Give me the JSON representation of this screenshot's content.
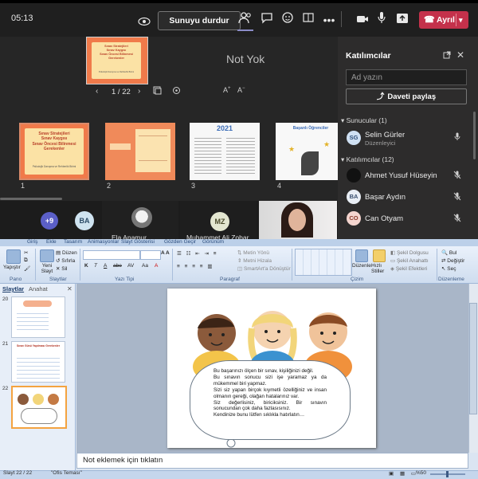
{
  "teams": {
    "timer": "05:13",
    "stop_share_label": "Sunuyu durdur",
    "leave_label": "Ayrıl",
    "stage_message": "Not Yok",
    "slide_pager": "1 / 22",
    "preview_title_lines": [
      "Sınav Stratejileri",
      "Sınav Kaygısı",
      "Sınav Öncesi Bilinmesi",
      "Gerekenler"
    ],
    "preview_footer": "Psikolojik Danışma ve Rehberlik Birimi",
    "thumbnails": [
      {
        "num": "1",
        "lines": [
          "Sınav Stratejileri",
          "Sınav Kaygısı",
          "Sınav Öncesi Bilinmesi",
          "Gerekenler"
        ],
        "footer": "Psikolojik Danışma ve Rehberlik Birimi"
      },
      {
        "num": "2"
      },
      {
        "num": "3",
        "heading": "2021"
      },
      {
        "num": "4",
        "heading": "Başarılı Öğrenciler"
      }
    ],
    "video_tiles": [
      {
        "initials": "+9"
      },
      {
        "initials": "BA"
      },
      {
        "name": "Ela Anamur"
      },
      {
        "initials": "MZ",
        "name": "Muhammet Ali Zobar"
      },
      {
        "type": "camera"
      }
    ],
    "panel": {
      "title": "Katılımcılar",
      "search_placeholder": "Ad yazın",
      "invite_label": "Daveti paylaş",
      "presenters_header": "Sunucular (1)",
      "attendees_header": "Katılımcılar (12)",
      "presenters": [
        {
          "initials": "SG",
          "name": "Selin Gürler",
          "role": "Düzenleyici",
          "color": "#cfe0f3"
        }
      ],
      "attendees": [
        {
          "initials": "",
          "name": "Ahmet Yusuf Hüseyin",
          "color": "#111111"
        },
        {
          "initials": "BA",
          "name": "Başar Aydın",
          "color": "#e9eef5"
        },
        {
          "initials": "CO",
          "name": "Can Otyam",
          "color": "#f4d5cf"
        }
      ]
    }
  },
  "ppt": {
    "ribbon_tabs": [
      "Giriş",
      "Ekle",
      "Tasarım",
      "Animasyonlar",
      "Slayt Gösterisi",
      "Gözden Geçir",
      "Görünüm"
    ],
    "ribbon_groups": [
      "Pano",
      "Slaytlar",
      "Yazı Tipi",
      "Paragraf",
      "Çizim",
      "Düzenleme"
    ],
    "pano_buttons": [
      "Yapıştır",
      "Kes",
      "Kopyala",
      "Biçim Boyacısı"
    ],
    "slaytlar_buttons": [
      "Yeni Slayt",
      "Düzen",
      "Sıfırla",
      "Sil"
    ],
    "paragraf_buttons": [
      "Metin Yönü",
      "Metni Hizala",
      "SmartArt'a Dönüştür"
    ],
    "cizim_buttons": [
      "Düzenle",
      "Hızlı Stiller",
      "Şekil Dolgusu",
      "Şekil Anahattı",
      "Şekil Efektleri"
    ],
    "duzenleme_buttons": [
      "Bul",
      "Değiştir",
      "Seç"
    ],
    "left_tabs": [
      "Slaytlar",
      "Anahat"
    ],
    "left_thumbnails": [
      {
        "num": "20"
      },
      {
        "num": "21",
        "heading": "Sınav Günü Yapılması Gerekenler"
      },
      {
        "num": "22"
      }
    ],
    "slide_text": [
      "Bu başarınızı ölçen bir sınav, kişiliğinizi değil.",
      "Bu sınavın sonucu sizi işe yaramaz ya da mükemmel biri yapmaz.",
      "Sizi siz yapan birçok kıymetli özelliğiniz ve insan olmanın gereği, olağan hatalarınız var.",
      "Siz değerlisiniz, biriciksiniz. Bir sınavın sonucundan çok daha fazlasısınız.",
      "Kendinize bunu lütfen sıklıkla hatırlatın…"
    ],
    "notes_placeholder": "Not eklemek için tıklatın",
    "status_slide": "Slayt 22 / 22",
    "status_theme": "\"Ofis Teması\"",
    "status_zoom": "%50"
  }
}
